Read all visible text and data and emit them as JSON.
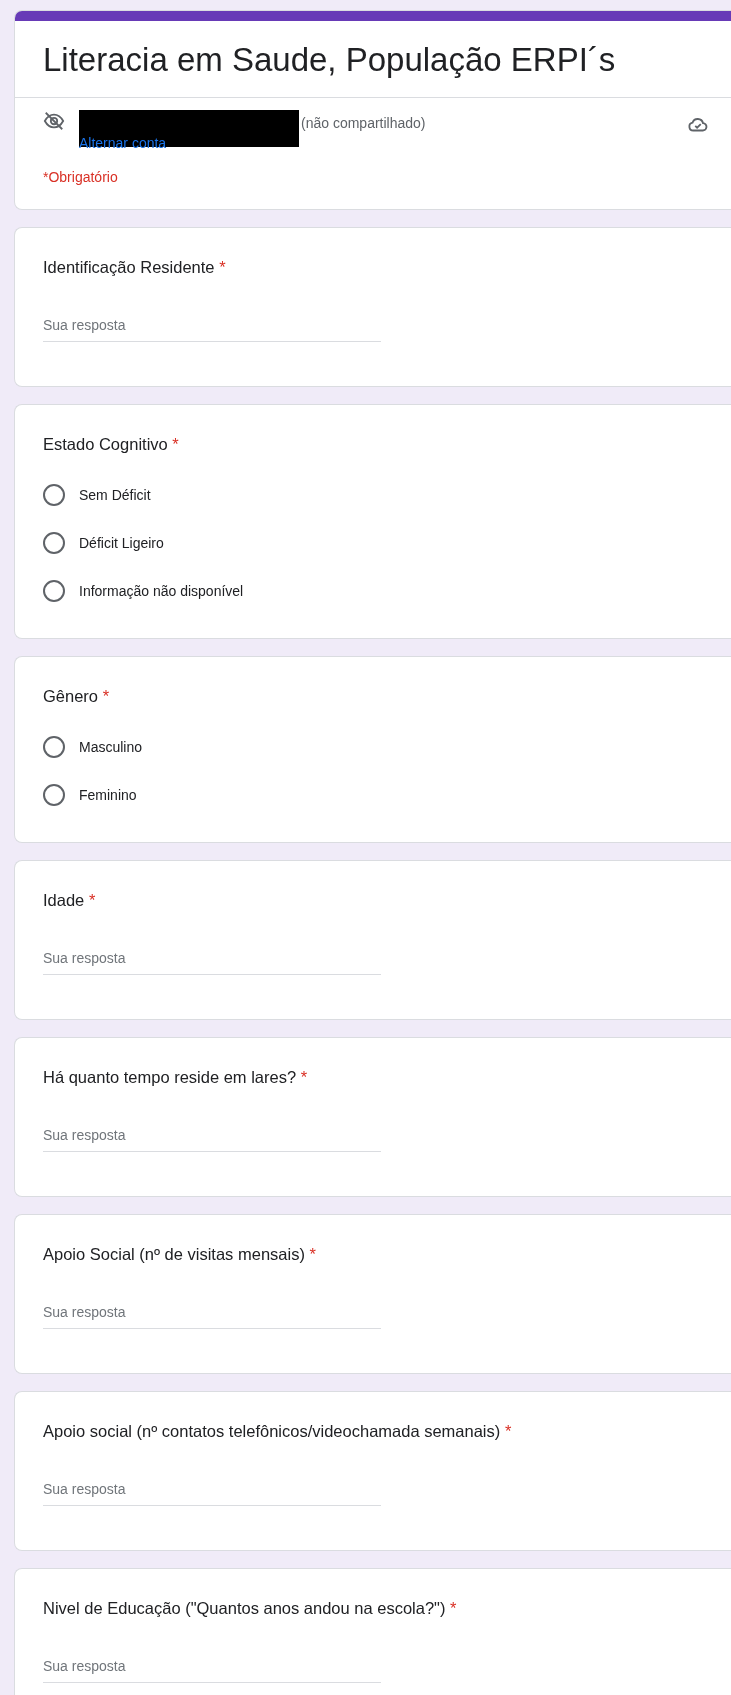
{
  "form": {
    "title": "Literacia em Saude, População ERPI´s",
    "account": {
      "shared_note": "(não compartilhado)",
      "switch_link": "Alternar conta"
    },
    "required_note": "*Obrigatório"
  },
  "questions": [
    {
      "kind": "text",
      "label": "Identificação Residente",
      "required_mark": "*",
      "placeholder": "Sua resposta"
    },
    {
      "kind": "radio",
      "label": "Estado Cognitivo",
      "required_mark": "*",
      "options": [
        {
          "label": "Sem Déficit",
          "selected": false
        },
        {
          "label": "Déficit Ligeiro",
          "selected": false
        },
        {
          "label": "Informação não disponível",
          "selected": false
        }
      ]
    },
    {
      "kind": "radio",
      "label": "Gênero",
      "required_mark": "*",
      "options": [
        {
          "label": "Masculino",
          "selected": false
        },
        {
          "label": "Feminino",
          "selected": false
        }
      ]
    },
    {
      "kind": "text",
      "label": "Idade",
      "required_mark": "*",
      "placeholder": "Sua resposta"
    },
    {
      "kind": "text",
      "label": "Há quanto tempo reside em lares?",
      "required_mark": "*",
      "placeholder": "Sua resposta"
    },
    {
      "kind": "text",
      "label": "Apoio Social (nº de visitas mensais)",
      "required_mark": "*",
      "placeholder": "Sua resposta"
    },
    {
      "kind": "text",
      "label": "Apoio social (nº contatos telefônicos/videochamada semanais)",
      "required_mark": "*",
      "placeholder": "Sua resposta"
    },
    {
      "kind": "text",
      "label": "Nivel de Educação (\"Quantos anos andou na escola?\")",
      "required_mark": "*",
      "placeholder": "Sua resposta"
    }
  ]
}
